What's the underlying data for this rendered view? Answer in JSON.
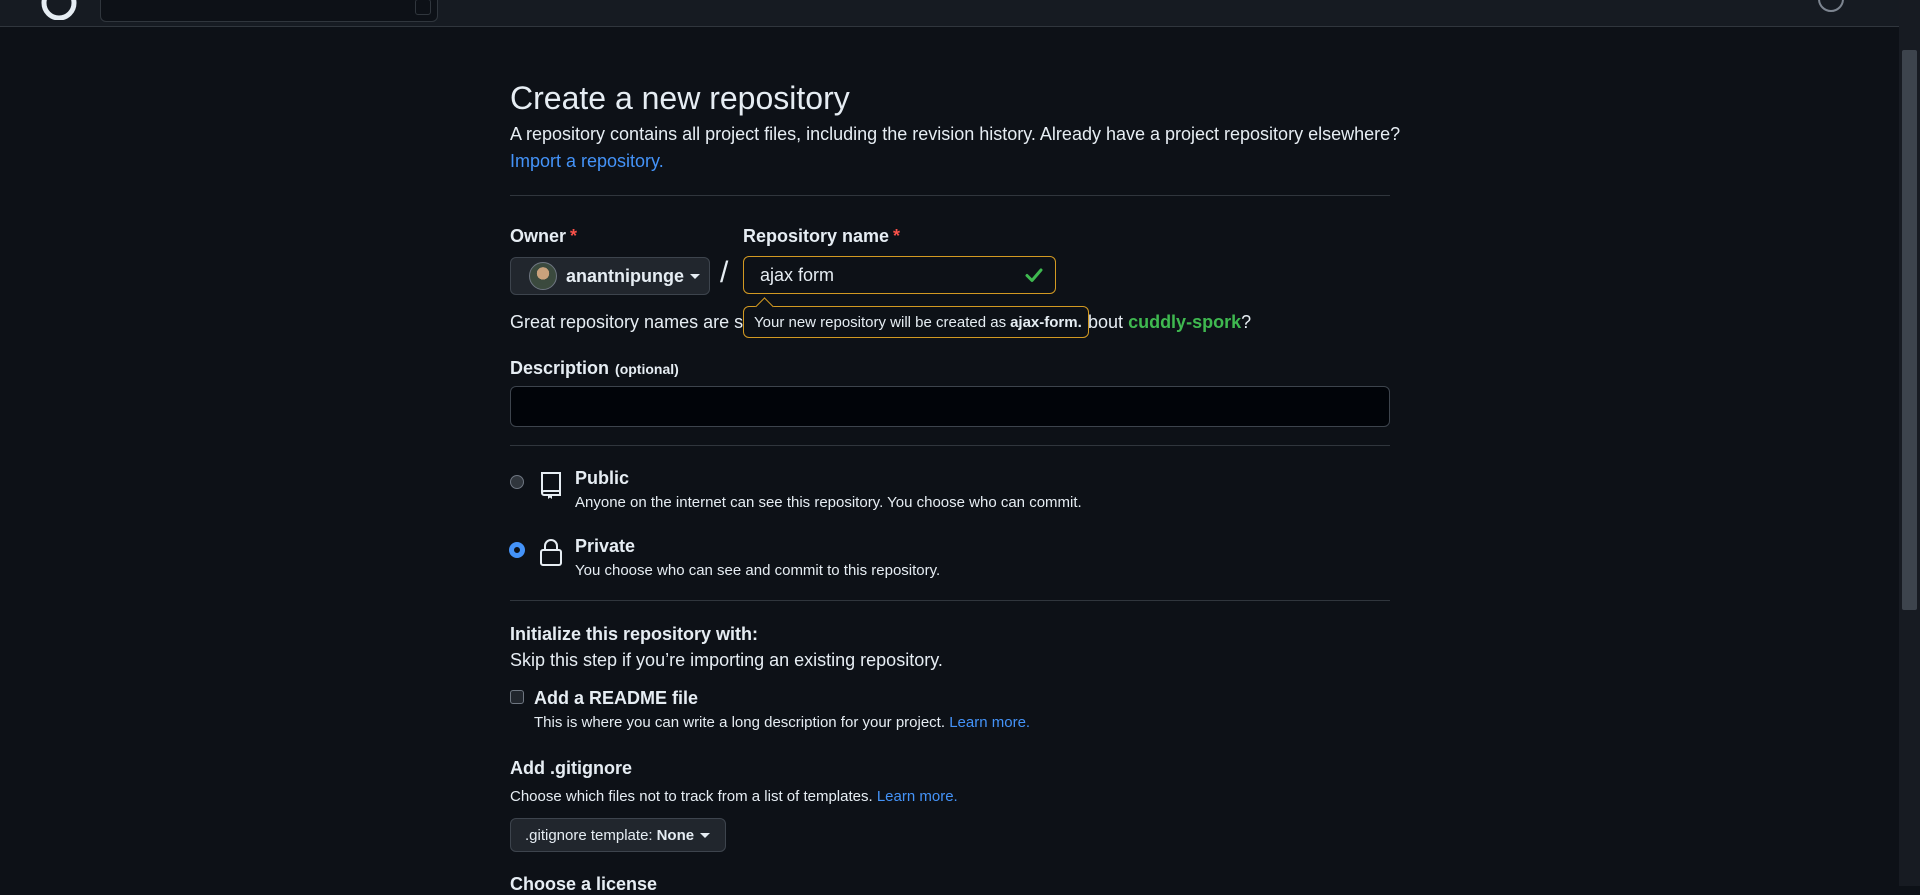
{
  "page": {
    "title": "Create a new repository",
    "lead": "A repository contains all project files, including the revision history. Already have a project repository elsewhere?",
    "import_link": "Import a repository."
  },
  "owner": {
    "label": "Owner",
    "required_mark": "*",
    "value": "anantnipunge"
  },
  "repo_name": {
    "label": "Repository name",
    "required_mark": "*",
    "value": "ajax form"
  },
  "separator": "/",
  "hint": {
    "prefix": "Great repository names are sh",
    "suffix": "bout",
    "suggestion": "cuddly-spork",
    "end": "?"
  },
  "tooltip": {
    "text": "Your new repository will be created as",
    "name": "ajax-form."
  },
  "description": {
    "label": "Description",
    "optional": "(optional)",
    "value": ""
  },
  "visibility": [
    {
      "title": "Public",
      "desc": "Anyone on the internet can see this repository. You choose who can commit.",
      "selected": false,
      "icon": "repo-icon"
    },
    {
      "title": "Private",
      "desc": "You choose who can see and commit to this repository.",
      "selected": true,
      "icon": "lock-icon"
    }
  ],
  "init": {
    "title": "Initialize this repository with:",
    "subtitle": "Skip this step if you’re importing an existing repository.",
    "readme_title": "Add a README file",
    "readme_desc": "This is where you can write a long description for your project.",
    "readme_learn": "Learn more."
  },
  "gitignore": {
    "title": "Add .gitignore",
    "desc": "Choose which files not to track from a list of templates.",
    "learn": "Learn more.",
    "button_label": ".gitignore template:",
    "button_value": "None"
  },
  "license": {
    "title": "Choose a license"
  },
  "colors": {
    "background": "#0d1117",
    "accent": "#4493f8",
    "warning": "#d29922",
    "success": "#3fb950",
    "danger": "#f85149"
  }
}
